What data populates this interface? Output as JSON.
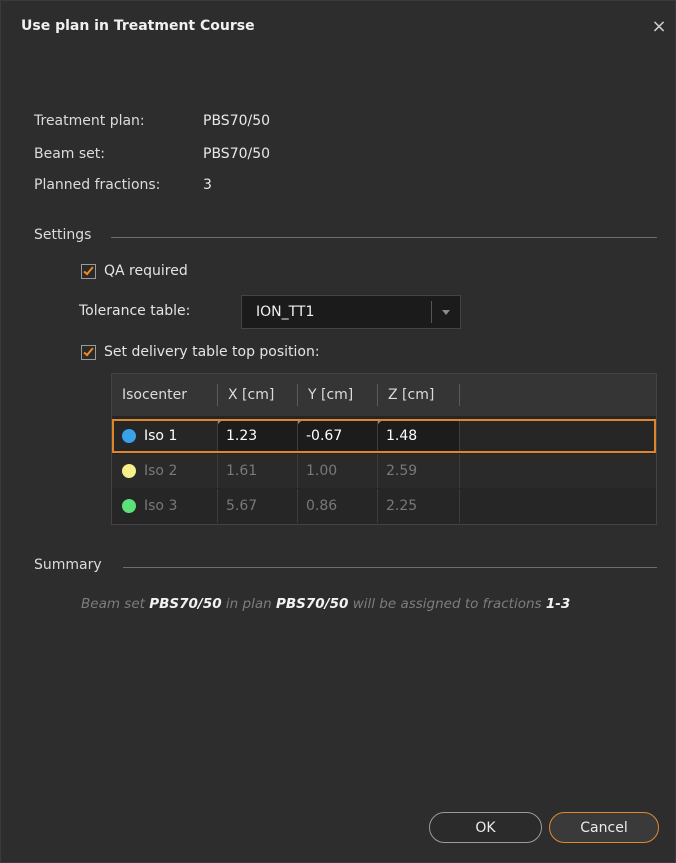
{
  "dialog": {
    "title": "Use plan in Treatment Course",
    "close_icon": "×"
  },
  "info": {
    "treatment_plan_label": "Treatment plan:",
    "treatment_plan_value": "PBS70/50",
    "beam_set_label": "Beam set:",
    "beam_set_value": "PBS70/50",
    "planned_fractions_label": "Planned fractions:",
    "planned_fractions_value": "3"
  },
  "settings": {
    "header": "Settings",
    "qa_required_label": "QA required",
    "qa_required_checked": true,
    "tolerance_table_label": "Tolerance table:",
    "tolerance_table_value": "ION_TT1",
    "set_delivery_label": "Set delivery table top position:",
    "set_delivery_checked": true
  },
  "isocenter_table": {
    "columns": [
      "Isocenter",
      "X [cm]",
      "Y [cm]",
      "Z [cm]"
    ],
    "rows": [
      {
        "name": "Iso 1",
        "color": "#3aa0e8",
        "x": "1.23",
        "y": "-0.67",
        "z": "1.48"
      },
      {
        "name": "Iso 2",
        "color": "#f5f08a",
        "x": "1.61",
        "y": "1.00",
        "z": "2.59"
      },
      {
        "name": "Iso 3",
        "color": "#5be07a",
        "x": "5.67",
        "y": "0.86",
        "z": "2.25"
      }
    ]
  },
  "summary": {
    "header": "Summary",
    "part1": "Beam set ",
    "beam_set": "PBS70/50",
    "part2": " in plan ",
    "plan": "PBS70/50",
    "part3": " will be assigned to fractions ",
    "fractions": "1-3"
  },
  "buttons": {
    "ok": "OK",
    "cancel": "Cancel"
  },
  "colors": {
    "accent": "#e08a2e",
    "background": "#2d2d2d"
  }
}
